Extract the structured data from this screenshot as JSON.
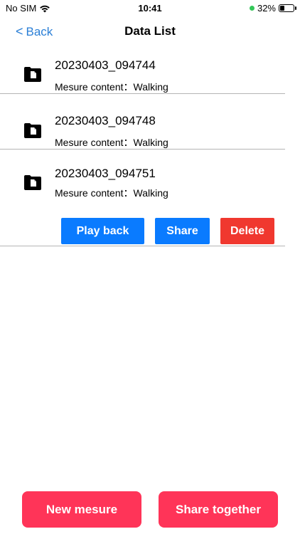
{
  "status_bar": {
    "carrier": "No SIM",
    "time": "10:41",
    "battery_percent": "32%",
    "battery_level": 0.32,
    "wifi_icon": "wifi-icon",
    "charging_dot_color": "#34c759"
  },
  "nav": {
    "back_label": "Back",
    "title": "Data List"
  },
  "items": [
    {
      "title": "20230403_094744",
      "subtitle": "Mesure content：Walking"
    },
    {
      "title": "20230403_094748",
      "subtitle": "Mesure content：Walking"
    },
    {
      "title": "20230403_094751",
      "subtitle": "Mesure content：Walking"
    }
  ],
  "item_actions": {
    "play_back": "Play back",
    "share": "Share",
    "delete": "Delete"
  },
  "bottom": {
    "new_mesure": "New mesure",
    "share_together": "Share together"
  },
  "colors": {
    "accent_blue": "#0a7bff",
    "back_blue": "#2b7fd6",
    "delete_red": "#f0382f",
    "bottom_pink": "#ff3458"
  }
}
